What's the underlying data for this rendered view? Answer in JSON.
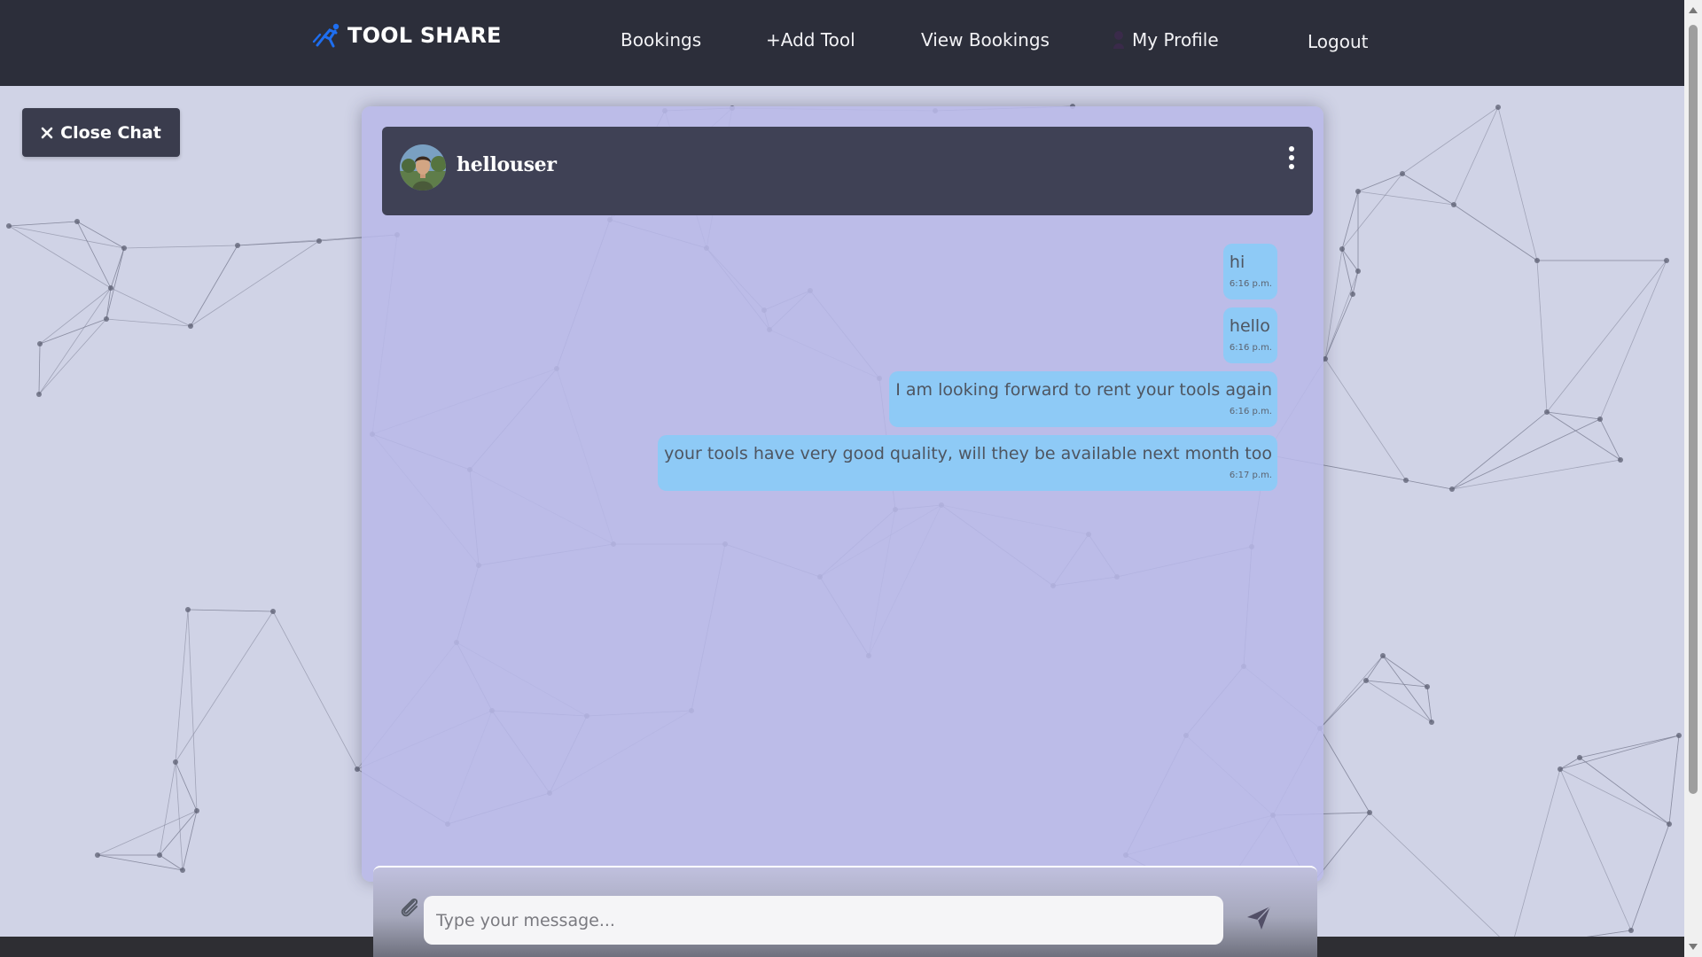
{
  "app": {
    "brand": "TOOL SHARE",
    "brand_icon": "runner-logo-icon",
    "accent": "#1e6ef0"
  },
  "nav": {
    "links": [
      {
        "label": "Bookings"
      },
      {
        "label": "+Add Tool"
      },
      {
        "label": "View Bookings"
      },
      {
        "label": "My Profile",
        "icon": "user-icon"
      },
      {
        "label": "Logout"
      }
    ]
  },
  "close_chat": {
    "label": "Close Chat",
    "icon": "close-icon"
  },
  "chat": {
    "username": "hellouser",
    "menu_icon": "more-vertical-icon",
    "messages": [
      {
        "text": "hi",
        "time": "6:16 p.m."
      },
      {
        "text": "hello",
        "time": "6:16 p.m."
      },
      {
        "text": "I am looking forward to rent your tools again",
        "time": "6:16 p.m."
      },
      {
        "text": "your tools have very good quality, will they be available next month too",
        "time": "6:17 p.m."
      }
    ],
    "bubble_color": "#8ecaf6"
  },
  "composer": {
    "placeholder": "Type your message...",
    "attach_icon": "paperclip-icon",
    "send_icon": "send-icon"
  }
}
